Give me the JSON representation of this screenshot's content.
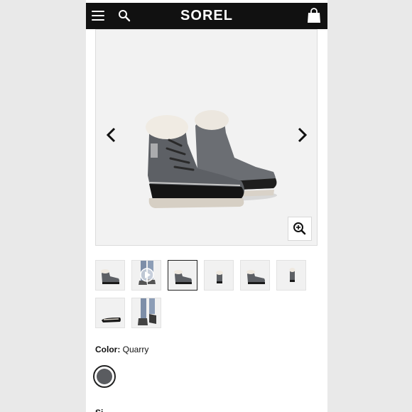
{
  "header": {
    "brand": "SOREL",
    "icons": [
      "menu-icon",
      "search-icon",
      "shopping-bag-icon"
    ]
  },
  "gallery": {
    "image_alt": "Women's Explorer Carnival boot in Quarry",
    "thumbnail_count": 8,
    "selected_thumbnail": 3
  },
  "color": {
    "label": "Color:",
    "value": "Quarry",
    "swatch_hex": "#5a5c60"
  },
  "size": {
    "label": "Si"
  },
  "colors": {
    "header_bg": "#111111",
    "accent": "#c8102e"
  }
}
